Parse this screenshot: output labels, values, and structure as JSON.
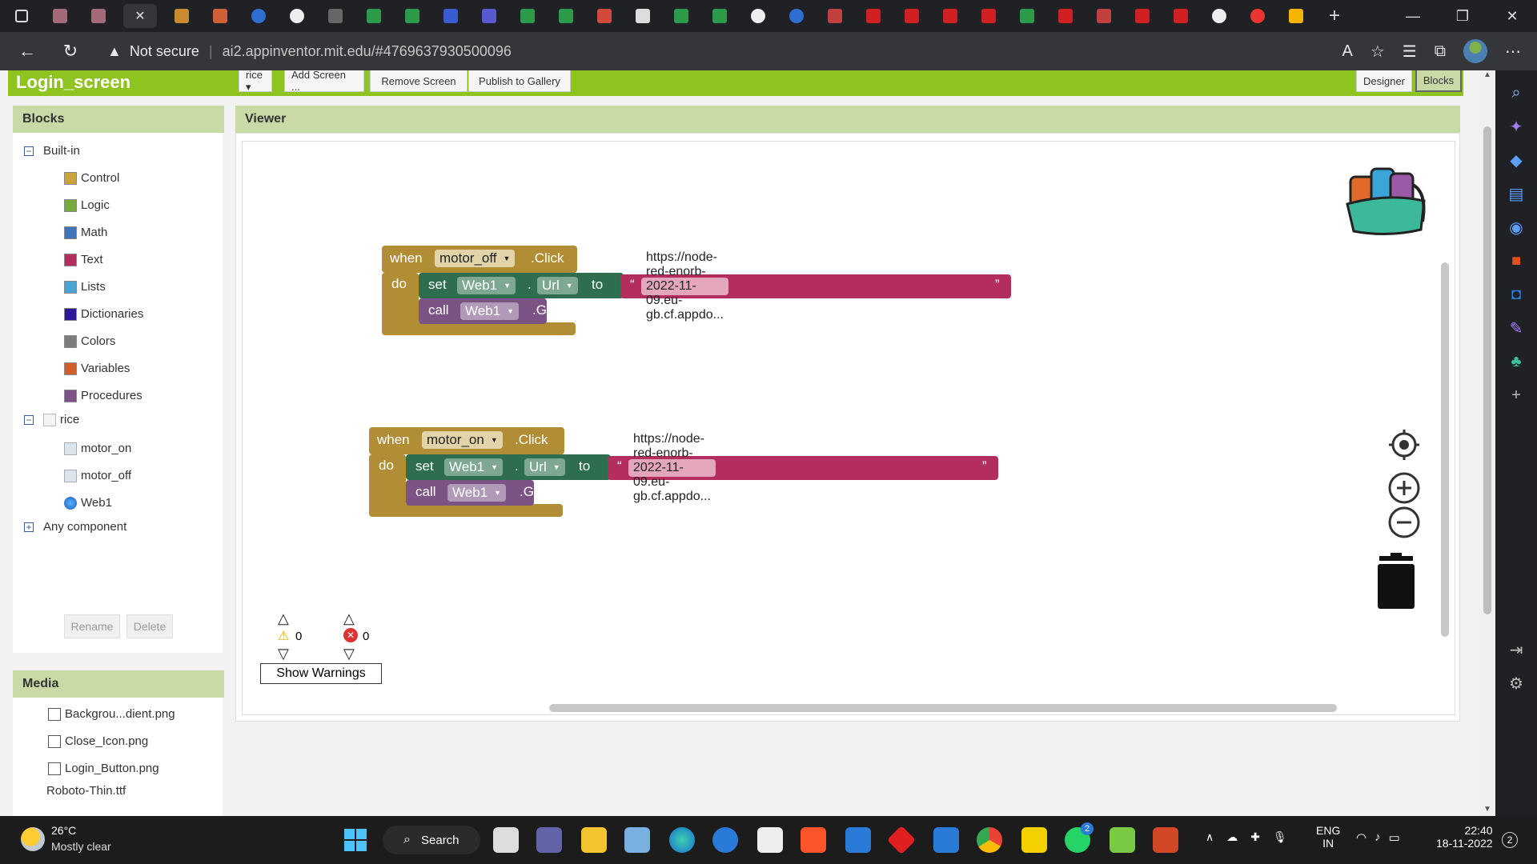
{
  "browser": {
    "address": {
      "security": "Not secure",
      "url": "ai2.appinventor.mit.edu/#4769637930500096"
    },
    "window_controls": [
      "—",
      "❐",
      "✕"
    ]
  },
  "app": {
    "screen_name": "Login_screen",
    "screen_dropdown": "rice ▾",
    "buttons": {
      "add_screen": "Add Screen ...",
      "remove_screen": "Remove Screen",
      "publish": "Publish to Gallery",
      "designer": "Designer",
      "blocks": "Blocks"
    }
  },
  "blocks_panel": {
    "title": "Blocks",
    "builtin_label": "Built-in",
    "builtin": [
      {
        "label": "Control",
        "color": "#c9a33b"
      },
      {
        "label": "Logic",
        "color": "#77ab41"
      },
      {
        "label": "Math",
        "color": "#3e75b9"
      },
      {
        "label": "Text",
        "color": "#b32d5e"
      },
      {
        "label": "Lists",
        "color": "#49a6d4"
      },
      {
        "label": "Dictionaries",
        "color": "#2d1799"
      },
      {
        "label": "Colors",
        "color": "#7d7d7d"
      },
      {
        "label": "Variables",
        "color": "#d05f2d"
      },
      {
        "label": "Procedures",
        "color": "#7c5385"
      }
    ],
    "screen_label": "rice",
    "components": [
      "motor_on",
      "motor_off",
      "Web1"
    ],
    "any_component": "Any component",
    "rename": "Rename",
    "delete": "Delete"
  },
  "media_panel": {
    "title": "Media",
    "files": [
      "Backgrou...dient.png",
      "Close_Icon.png",
      "Login_Button.png",
      "Roboto-Thin.ttf"
    ]
  },
  "viewer": {
    "title": "Viewer",
    "block1": {
      "when": "when",
      "component": "motor_off",
      "event": ".Click",
      "do": "do",
      "set": "set",
      "web": "Web1",
      "dot": ".",
      "prop": "Url",
      "to": "to",
      "url": "https://node-red-enorb-2022-11-09.eu-gb.cf.appdo...",
      "call": "call",
      "method": ".Get"
    },
    "block2": {
      "when": "when",
      "component": "motor_on",
      "event": ".Click",
      "do": "do",
      "set": "set",
      "web": "Web1",
      "dot": ".",
      "prop": "Url",
      "to": "to",
      "url": "https://node-red-enorb-2022-11-09.eu-gb.cf.appdo...",
      "call": "call",
      "method": ".Get"
    },
    "warning_count": "0",
    "error_count": "0",
    "show_warnings": "Show Warnings"
  },
  "taskbar": {
    "weather_temp": "26°C",
    "weather_desc": "Mostly clear",
    "search": "Search",
    "lang1": "ENG",
    "lang2": "IN",
    "time": "22:40",
    "date": "18-11-2022",
    "notif": "2",
    "whatsapp_badge": "2"
  }
}
